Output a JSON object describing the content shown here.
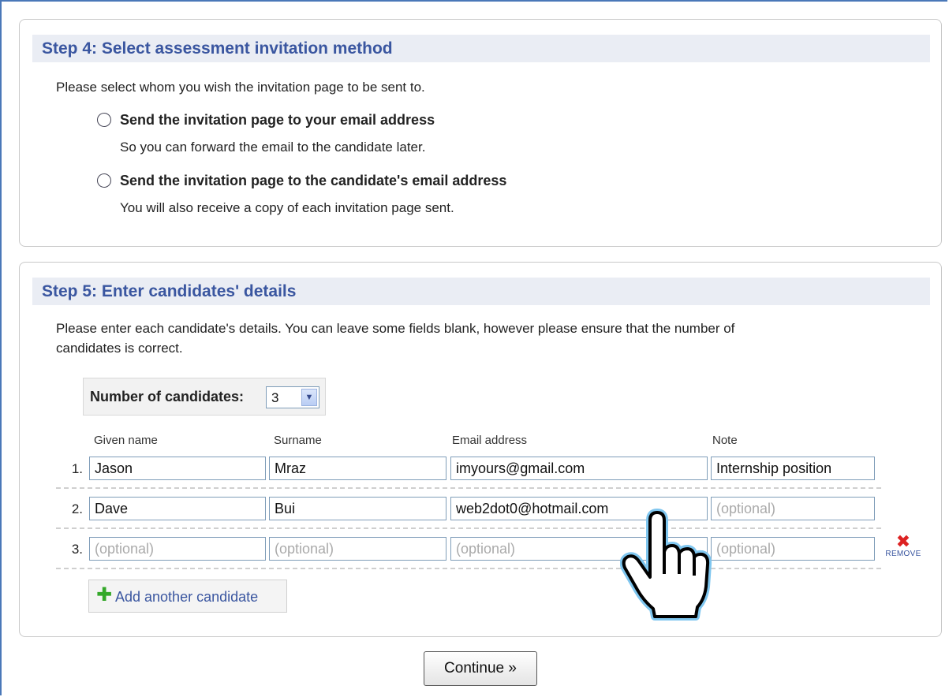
{
  "step4": {
    "title": "Step 4: Select assessment invitation method",
    "instruction": "Please select whom you wish the invitation page to be sent to.",
    "options": [
      {
        "label": "Send the invitation page to your email address",
        "sublabel": "So you can forward the email to the candidate later.",
        "selected": false
      },
      {
        "label": "Send the invitation page to the candidate's email address",
        "sublabel": "You will also receive a copy of each invitation page sent.",
        "selected": false
      }
    ]
  },
  "step5": {
    "title": "Step 5: Enter candidates' details",
    "instruction_line1": "Please enter each candidate's details. You can leave some fields blank, however please ensure that the number of",
    "instruction_line2": "candidates is correct.",
    "count_label": "Number of candidates:",
    "count_value": "3",
    "columns": [
      "Given name",
      "Surname",
      "Email address",
      "Note"
    ],
    "placeholder": "(optional)",
    "rows": [
      {
        "num": "1.",
        "given": "Jason",
        "surname": "Mraz",
        "email": "imyours@gmail.com",
        "note": "Internship position"
      },
      {
        "num": "2.",
        "given": "Dave",
        "surname": "Bui",
        "email": "web2dot0@hotmail.com",
        "note": ""
      },
      {
        "num": "3.",
        "given": "",
        "surname": "",
        "email": "",
        "note": ""
      }
    ],
    "remove_label": "REMOVE",
    "add_label": "Add another candidate"
  },
  "continue_label": "Continue »",
  "colors": {
    "header_bg": "#eaedf4",
    "header_text": "#3a56a0",
    "add_icon": "#34a82a",
    "remove_icon": "#dd2222"
  },
  "icons": {
    "add": "plus-icon",
    "remove": "close-x-icon",
    "cursor": "hand-pointer-icon"
  }
}
